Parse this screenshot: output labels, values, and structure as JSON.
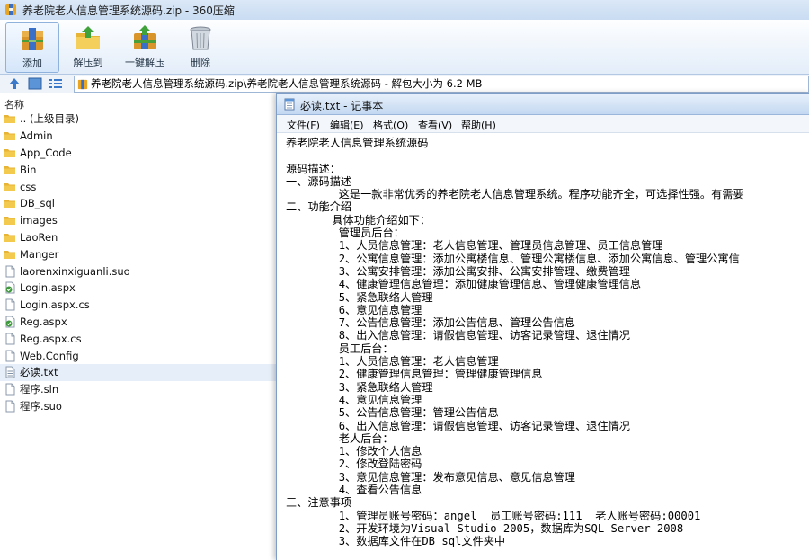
{
  "window": {
    "title": "养老院老人信息管理系统源码.zip - 360压缩"
  },
  "toolbar": {
    "buttons": [
      {
        "label": "添加",
        "icon": "archive-add-icon"
      },
      {
        "label": "解压到",
        "icon": "extract-folder-icon"
      },
      {
        "label": "一键解压",
        "icon": "one-click-extract-icon"
      },
      {
        "label": "删除",
        "icon": "trash-icon"
      }
    ]
  },
  "address": {
    "path": "养老院老人信息管理系统源码.zip\\养老院老人信息管理系统源码 - 解包大小为 6.2 MB"
  },
  "filelist": {
    "header": "名称",
    "items": [
      {
        "name": ".. (上级目录)",
        "type": "folder"
      },
      {
        "name": "Admin",
        "type": "folder"
      },
      {
        "name": "App_Code",
        "type": "folder"
      },
      {
        "name": "Bin",
        "type": "folder"
      },
      {
        "name": "css",
        "type": "folder"
      },
      {
        "name": "DB_sql",
        "type": "folder"
      },
      {
        "name": "images",
        "type": "folder"
      },
      {
        "name": "LaoRen",
        "type": "folder"
      },
      {
        "name": "Manger",
        "type": "folder"
      },
      {
        "name": "laorenxinxiguanli.suo",
        "type": "file"
      },
      {
        "name": "Login.aspx",
        "type": "aspx"
      },
      {
        "name": "Login.aspx.cs",
        "type": "file"
      },
      {
        "name": "Reg.aspx",
        "type": "aspx"
      },
      {
        "name": "Reg.aspx.cs",
        "type": "file"
      },
      {
        "name": "Web.Config",
        "type": "file"
      },
      {
        "name": "必读.txt",
        "type": "txt",
        "selected": true
      },
      {
        "name": "程序.sln",
        "type": "file"
      },
      {
        "name": "程序.suo",
        "type": "file"
      }
    ]
  },
  "notepad": {
    "title": "必读.txt - 记事本",
    "menu": [
      "文件(F)",
      "编辑(E)",
      "格式(O)",
      "查看(V)",
      "帮助(H)"
    ],
    "lines": [
      "养老院老人信息管理系统源码",
      "",
      "源码描述：",
      "一、源码描述",
      "        这是一款非常优秀的养老院老人信息管理系统。程序功能齐全，可选择性强。有需要",
      "二、功能介绍",
      "       具体功能介绍如下：",
      "        管理员后台：",
      "        1、人员信息管理：老人信息管理、管理员信息管理、员工信息管理",
      "        2、公寓信息管理：添加公寓楼信息、管理公寓楼信息、添加公寓信息、管理公寓信",
      "        3、公寓安排管理：添加公寓安排、公寓安排管理、缴费管理",
      "        4、健康管理信息管理：添加健康管理信息、管理健康管理信息",
      "        5、紧急联络人管理",
      "        6、意见信息管理",
      "        7、公告信息管理：添加公告信息、管理公告信息",
      "        8、出入信息管理：请假信息管理、访客记录管理、退住情况",
      "        员工后台：",
      "        1、人员信息管理：老人信息管理",
      "        2、健康管理信息管理：管理健康管理信息",
      "        3、紧急联络人管理",
      "        4、意见信息管理",
      "        5、公告信息管理：管理公告信息",
      "        6、出入信息管理：请假信息管理、访客记录管理、退住情况",
      "        老人后台：",
      "        1、修改个人信息",
      "        2、修改登陆密码",
      "        3、意见信息管理：发布意见信息、意见信息管理",
      "        4、查看公告信息",
      "三、注意事项",
      "        1、管理员账号密码：angel  员工账号密码:111  老人账号密码:00001",
      "        2、开发环境为Visual Studio 2005，数据库为SQL Server 2008",
      "        3、数据库文件在DB_sql文件夹中"
    ]
  },
  "colors": {
    "accent": "#3a78c9",
    "folder": "#e8b436",
    "selection": "#e6eef9"
  }
}
